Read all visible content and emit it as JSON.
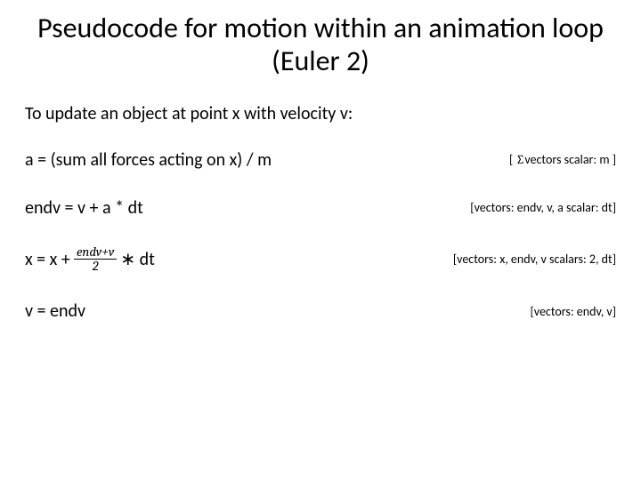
{
  "title": "Pseudocode for motion within an animation loop (Euler 2)",
  "intro": "To update an object at point x with velocity v:",
  "lines": {
    "l1": {
      "formula": "a = (sum all forces acting on x) / m",
      "annot_pre": "[  ",
      "annot_sigma": "∑",
      "annot_post": "vectors   scalar: m   ]"
    },
    "l2": {
      "formula": "endv = v + a * dt",
      "annot": "[vectors: endv, v, a    scalar: dt]"
    },
    "l3": {
      "prefix": "x = x + ",
      "frac_num": "endv+v",
      "frac_den": "2",
      "suffix": " ∗ dt",
      "annot": "[vectors: x, endv, v    scalars: 2, dt]"
    },
    "l4": {
      "formula": "v = endv",
      "annot": "[vectors: endv, v]"
    }
  }
}
